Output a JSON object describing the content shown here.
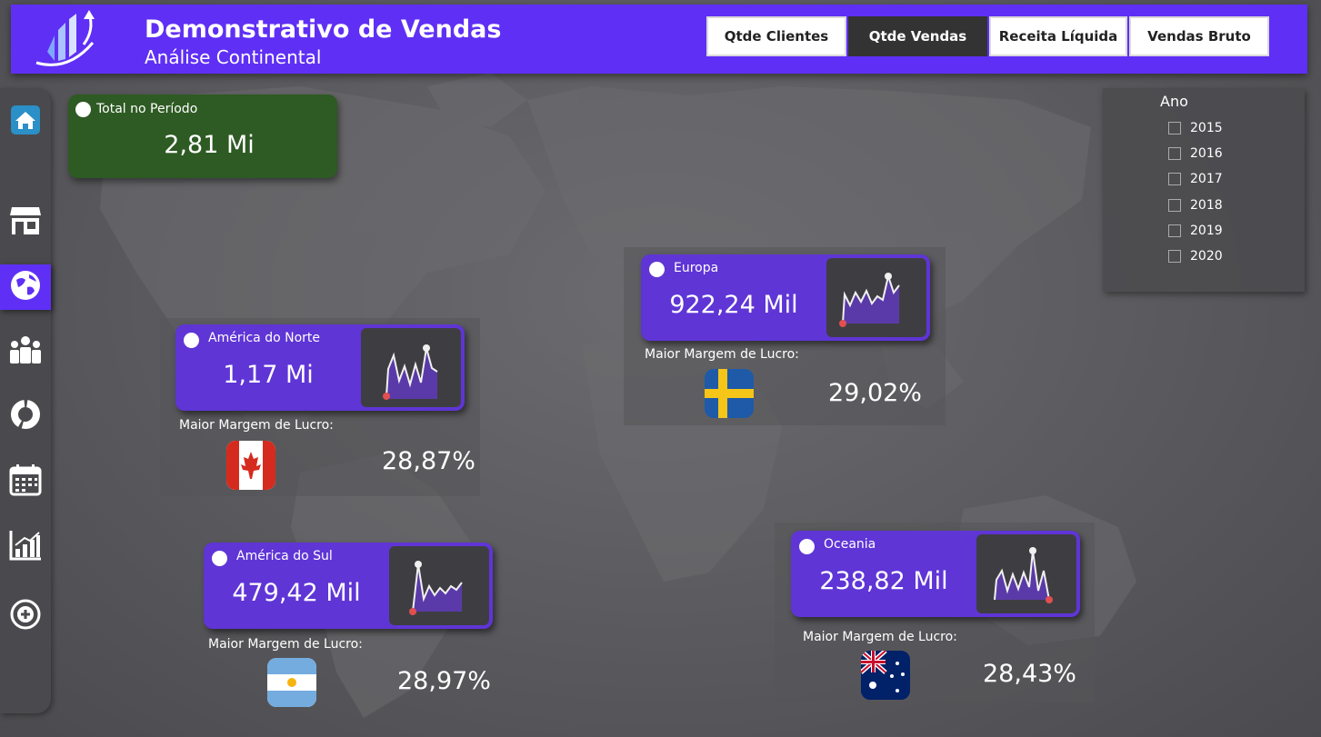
{
  "header": {
    "title": "Demonstrativo de Vendas",
    "subtitle": "Análise Continental",
    "tabs": [
      {
        "label": "Qtde Clientes",
        "active": false
      },
      {
        "label": "Qtde Vendas",
        "active": true
      },
      {
        "label": "Receita Líquida",
        "active": false
      },
      {
        "label": "Vendas Bruto",
        "active": false
      }
    ]
  },
  "sidebar": {
    "items": [
      {
        "icon": "home-icon",
        "active": false
      },
      {
        "icon": "store-icon",
        "active": false
      },
      {
        "icon": "globe-icon",
        "active": true
      },
      {
        "icon": "people-icon",
        "active": false
      },
      {
        "icon": "donut-chart-icon",
        "active": false
      },
      {
        "icon": "calendar-icon",
        "active": false
      },
      {
        "icon": "bar-chart-icon",
        "active": false
      },
      {
        "icon": "add-target-icon",
        "active": false
      }
    ]
  },
  "total": {
    "label": "Total no Período",
    "value": "2,81 Mi"
  },
  "year_filter": {
    "title": "Ano",
    "options": [
      "2015",
      "2016",
      "2017",
      "2018",
      "2019",
      "2020"
    ]
  },
  "regions": {
    "north_america": {
      "name": "América do Norte",
      "value": "1,17 Mi",
      "margin_label": "Maior Margem de Lucro:",
      "margin": "28,87%",
      "flag": "canada-flag-icon"
    },
    "europe": {
      "name": "Europa",
      "value": "922,24 Mil",
      "margin_label": "Maior Margem de Lucro:",
      "margin": "29,02%",
      "flag": "sweden-flag-icon"
    },
    "south_america": {
      "name": "América do Sul",
      "value": "479,42 Mil",
      "margin_label": "Maior Margem de Lucro:",
      "margin": "28,97%",
      "flag": "argentina-flag-icon"
    },
    "oceania": {
      "name": "Oceania",
      "value": "238,82 Mil",
      "margin_label": "Maior Margem de Lucro:",
      "margin": "28,43%",
      "flag": "australia-flag-icon"
    }
  },
  "colors": {
    "header": "#5f2ff5",
    "card": "#5f35d6",
    "total_card": "#2e5a23",
    "spark_fill": "#5a3aa8",
    "spark_line": "#f0f0f0",
    "spark_min": "#e05050"
  }
}
